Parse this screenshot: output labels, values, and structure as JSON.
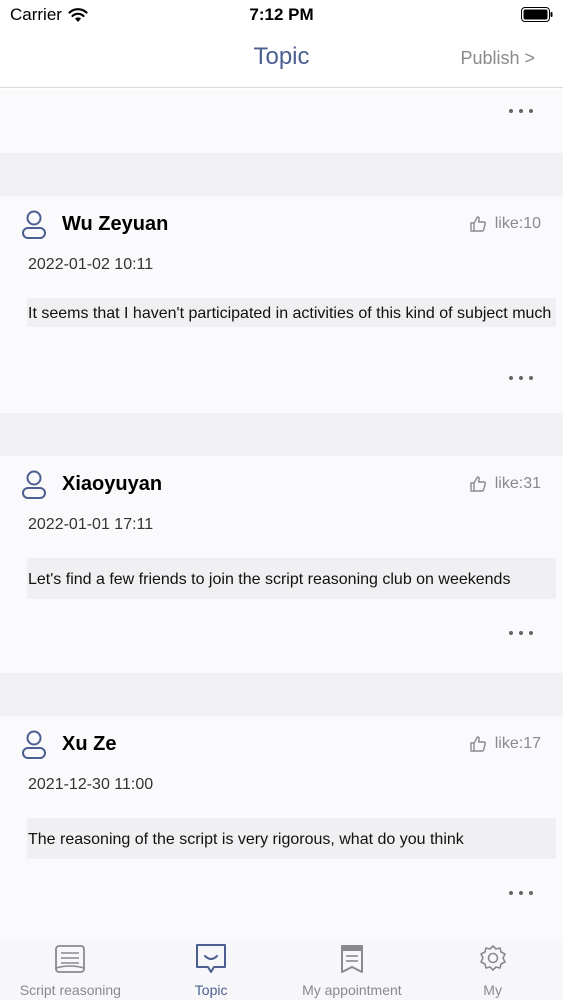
{
  "status": {
    "carrier": "Carrier",
    "time": "7:12 PM"
  },
  "nav": {
    "title": "Topic",
    "publish": "Publish >"
  },
  "posts": [
    {
      "author": "Wu Zeyuan",
      "date": "2022-01-02 10:11",
      "likes": "like:10",
      "content": "It seems that I haven't participated in activities of this kind of subject much"
    },
    {
      "author": "Xiaoyuyan",
      "date": "2022-01-01 17:11",
      "likes": "like:31",
      "content": "Let's find a few friends to join the script reasoning club on weekends"
    },
    {
      "author": "Xu Ze",
      "date": "2021-12-30 11:00",
      "likes": "like:17",
      "content": "The reasoning of the script is very rigorous, what do you think"
    }
  ],
  "tabs": [
    {
      "label": "Script reasoning",
      "icon": "book-icon",
      "active": false
    },
    {
      "label": "Topic",
      "icon": "chat-bubble-icon",
      "active": true
    },
    {
      "label": "My appointment",
      "icon": "bookmark-icon",
      "active": false
    },
    {
      "label": "My",
      "icon": "gear-icon",
      "active": false
    }
  ],
  "colors": {
    "accent": "#4b5f91",
    "muted": "#8a8a8e",
    "gap": "#f1f1f4",
    "card": "#fafafc"
  }
}
